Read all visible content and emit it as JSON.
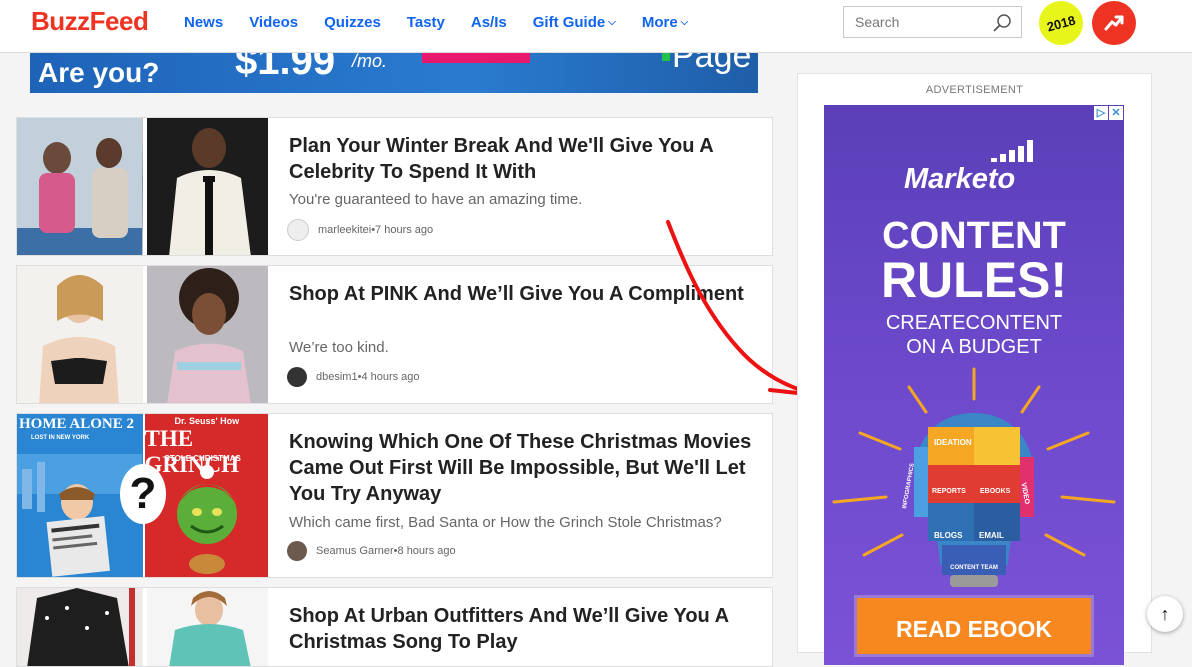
{
  "header": {
    "logo": "BuzzFeed",
    "nav": [
      {
        "label": "News",
        "dropdown": false
      },
      {
        "label": "Videos",
        "dropdown": false
      },
      {
        "label": "Quizzes",
        "dropdown": false
      },
      {
        "label": "Tasty",
        "dropdown": false
      },
      {
        "label": "As/Is",
        "dropdown": false
      },
      {
        "label": "Gift Guide",
        "dropdown": true
      },
      {
        "label": "More",
        "dropdown": true
      }
    ],
    "search_placeholder": "Search",
    "badge_label": "2018",
    "brand_color": "#ee3322",
    "nav_color": "#0f65ef"
  },
  "top_ad": {
    "question": "Are you?",
    "price": "$1.99",
    "per": "/mo.",
    "brand": "Page"
  },
  "cards": [
    {
      "title": "Plan Your Winter Break And We'll Give You A Celebrity To Spend It With",
      "description": "You're guaranteed to have an amazing time.",
      "author": "marleekitei",
      "time": "7 hours ago"
    },
    {
      "title": "Shop At PINK And We’ll Give You A Compliment",
      "description": "We’re too kind.",
      "author": "dbesim1",
      "time": "4 hours ago"
    },
    {
      "title": "Knowing Which One Of These Christmas Movies Came Out First Will Be Impossible, But We'll Let You Try Anyway",
      "description": "Which came first, Bad Santa or How the Grinch Stole Christmas?",
      "author": "Seamus Garner",
      "time": "8 hours ago",
      "thumb_left_text": "HOME ALONE 2",
      "thumb_left_sub": "LOST IN NEW YORK",
      "thumb_right_top": "Dr. Seuss' How",
      "thumb_right_text": "THE GRINCH",
      "thumb_right_sub": "STOLE CHRISTMAS",
      "question_mark": "?"
    },
    {
      "title": "Shop At Urban Outfitters And We’ll Give You A Christmas Song To Play"
    }
  ],
  "byline_separator": " • ",
  "sidebar_ad": {
    "label": "ADVERTISEMENT",
    "brand": "Marketo",
    "headline_1": "CONTENT",
    "headline_2": "RULES!",
    "subhead_1": "CREATECONTENT",
    "subhead_2": "ON A BUDGET",
    "bulb_labels": [
      "IDEATION",
      "REPORTS",
      "EBOOKS",
      "BLOGS",
      "EMAIL",
      "INFOGRAPHICS",
      "VIDEO",
      "CONTENT TEAM"
    ],
    "cta": "READ EBOOK",
    "cta_color": "#f7871f"
  },
  "scroll_top_icon": "arrow-up-icon"
}
